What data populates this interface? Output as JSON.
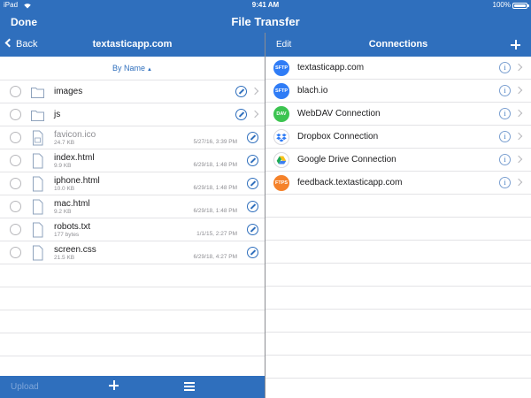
{
  "status_bar": {
    "device": "iPad",
    "time": "9:41 AM",
    "battery": "100%"
  },
  "window": {
    "left_button": "Done",
    "title": "File Transfer"
  },
  "local": {
    "back_label": "Back",
    "title": "textasticapp.com",
    "sort_label": "By Name",
    "sort_arrow": "▲",
    "items": [
      {
        "name": "images",
        "type": "folder"
      },
      {
        "name": "js",
        "type": "folder"
      },
      {
        "name": "favicon.ico",
        "type": "image",
        "size": "24.7 KB",
        "date": "5/27/16, 3:39 PM",
        "dim": true
      },
      {
        "name": "index.html",
        "type": "file",
        "size": "9.9 KB",
        "date": "6/29/18, 1:48 PM"
      },
      {
        "name": "iphone.html",
        "type": "file",
        "size": "10.0 KB",
        "date": "6/29/18, 1:48 PM"
      },
      {
        "name": "mac.html",
        "type": "file",
        "size": "9.2 KB",
        "date": "6/29/18, 1:48 PM"
      },
      {
        "name": "robots.txt",
        "type": "file",
        "size": "177 bytes",
        "date": "1/1/15, 2:27 PM"
      },
      {
        "name": "screen.css",
        "type": "file",
        "size": "21.5 KB",
        "date": "6/29/18, 4:27 PM"
      }
    ],
    "toolbar": {
      "upload_label": "Upload"
    }
  },
  "connections": {
    "edit_label": "Edit",
    "title": "Connections",
    "items": [
      {
        "protocol": "SFTP",
        "name": "textasticapp.com",
        "color": "#2f7cf6",
        "icon": "sftp-icon"
      },
      {
        "protocol": "SFTP",
        "name": "blach.io",
        "color": "#2f7cf6",
        "icon": "sftp-icon"
      },
      {
        "protocol": "DAV",
        "name": "WebDAV Connection",
        "color": "#3cc450",
        "icon": "webdav-icon"
      },
      {
        "protocol": "",
        "name": "Dropbox Connection",
        "color": "#ffffff",
        "icon": "dropbox-icon"
      },
      {
        "protocol": "",
        "name": "Google Drive Connection",
        "color": "#ffffff",
        "icon": "google-drive-icon"
      },
      {
        "protocol": "FTPS",
        "name": "feedback.textasticapp.com",
        "color": "#f5822a",
        "icon": "ftps-icon"
      }
    ]
  },
  "colors": {
    "accent": "#2f6fbd",
    "separator": "#e3e3e6"
  }
}
